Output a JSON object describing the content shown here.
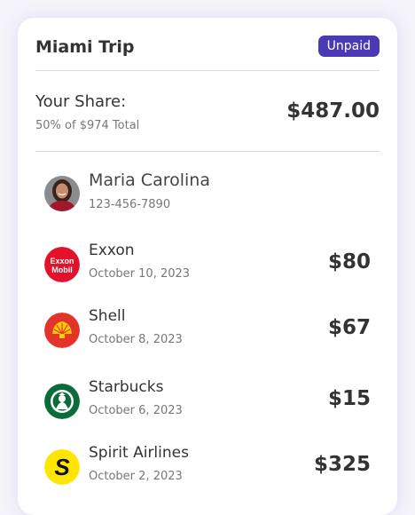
{
  "trip": {
    "title": "Miami Trip",
    "status": "Unpaid",
    "status_color": "#4b3ab5"
  },
  "share": {
    "label": "Your Share:",
    "subtitle": "50% of $974 Total",
    "amount": "$487.00"
  },
  "person": {
    "name": "Maria Carolina",
    "phone": "123-456-7890"
  },
  "transactions": [
    {
      "merchant": "Exxon",
      "date": "October 10, 2023",
      "amount": "$80",
      "logo": "exxon-mobil-logo",
      "logo_text_1": "Exxon",
      "logo_text_2": "Mobil",
      "color": "#e3122a"
    },
    {
      "merchant": "Shell",
      "date": "October 8, 2023",
      "amount": "$67",
      "logo": "shell-logo",
      "color": "#e3342a"
    },
    {
      "merchant": "Starbucks",
      "date": "October 6, 2023",
      "amount": "$15",
      "logo": "starbucks-logo",
      "color": "#0b6b3a"
    },
    {
      "merchant": "Spirit Airlines",
      "date": "October 2, 2023",
      "amount": "$325",
      "logo": "spirit-airlines-logo",
      "logo_text": "S",
      "color": "#ffe600"
    }
  ]
}
